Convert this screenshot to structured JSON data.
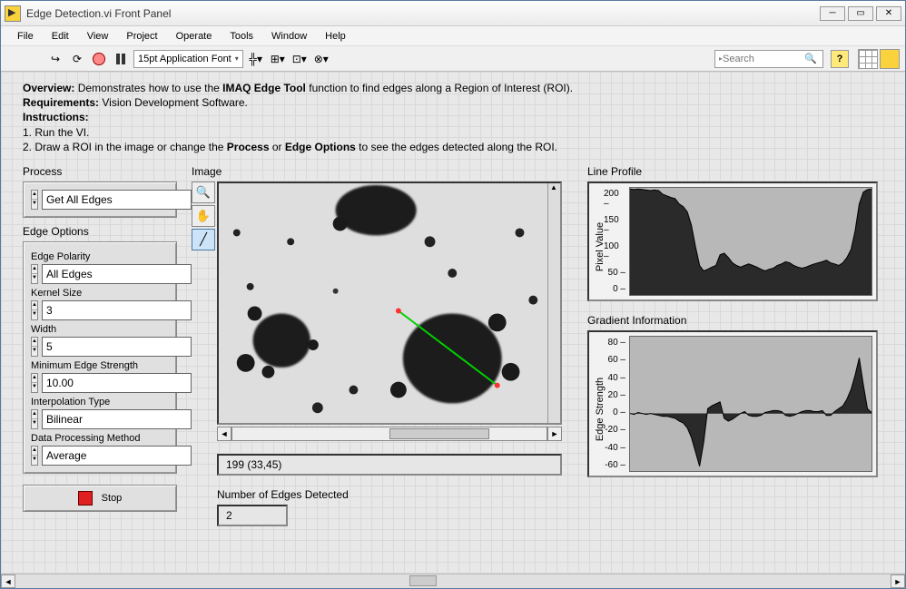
{
  "window": {
    "title": "Edge Detection.vi Front Panel"
  },
  "menu": [
    "File",
    "Edit",
    "View",
    "Project",
    "Operate",
    "Tools",
    "Window",
    "Help"
  ],
  "toolbar": {
    "font": "15pt Application Font",
    "search_placeholder": "Search"
  },
  "overview": {
    "l1a": "Overview:",
    "l1b": " Demonstrates how to use the ",
    "l1c": "IMAQ Edge Tool",
    "l1d": " function to find edges along a Region of Interest (ROI).",
    "l2a": "Requirements:",
    "l2b": " Vision Development Software.",
    "l3": "Instructions:",
    "l4": "1. Run the VI.",
    "l5a": "2. Draw a ROI in the image or change the ",
    "l5b": "Process",
    "l5c": " or ",
    "l5d": "Edge Options",
    "l5e": " to see the edges detected along the ROI."
  },
  "labels": {
    "process": "Process",
    "edge_options": "Edge Options",
    "edge_polarity": "Edge Polarity",
    "kernel_size": "Kernel Size",
    "width": "Width",
    "min_edge": "Minimum Edge Strength",
    "interp": "Interpolation Type",
    "dpm": "Data Processing Method",
    "stop": "Stop",
    "image": "Image",
    "ned": "Number of Edges Detected",
    "line_profile": "Line Profile",
    "gradient": "Gradient Information",
    "pixel_value": "Pixel Value",
    "edge_strength": "Edge Strength"
  },
  "controls": {
    "process": "Get All Edges",
    "edge_polarity": "All Edges",
    "kernel_size": "3",
    "width": "5",
    "min_edge": "10.00",
    "interp": "Bilinear",
    "dpm": "Average"
  },
  "status": "199    (33,45)",
  "ned": "2",
  "chart_data": [
    {
      "type": "line",
      "title": "Line Profile",
      "ylabel": "Pixel Value",
      "ylim": [
        0,
        200
      ],
      "yticks": [
        0,
        50,
        100,
        150,
        200
      ],
      "values": [
        198,
        197,
        198,
        197,
        196,
        195,
        196,
        195,
        188,
        185,
        182,
        180,
        170,
        165,
        155,
        130,
        90,
        55,
        45,
        48,
        52,
        55,
        75,
        78,
        70,
        60,
        55,
        52,
        55,
        58,
        55,
        52,
        48,
        45,
        48,
        50,
        55,
        58,
        62,
        60,
        55,
        52,
        50,
        52,
        55,
        58,
        60,
        62,
        65,
        60,
        58,
        55,
        60,
        70,
        85,
        120,
        170,
        192,
        197,
        198
      ]
    },
    {
      "type": "line",
      "title": "Gradient Information",
      "ylabel": "Edge Strength",
      "ylim": [
        -60,
        80
      ],
      "yticks": [
        -60,
        -40,
        -20,
        0,
        20,
        40,
        60,
        80
      ],
      "values": [
        0,
        -1,
        1,
        0,
        -1,
        0,
        -1,
        -2,
        -3,
        -3,
        -4,
        -5,
        -8,
        -10,
        -15,
        -25,
        -40,
        -55,
        -30,
        5,
        8,
        10,
        12,
        -5,
        -8,
        -6,
        -3,
        0,
        2,
        -2,
        -3,
        -3,
        -2,
        1,
        2,
        3,
        3,
        2,
        -2,
        -3,
        -2,
        0,
        2,
        3,
        3,
        2,
        2,
        3,
        -2,
        -2,
        2,
        5,
        8,
        15,
        25,
        40,
        58,
        30,
        5,
        1
      ]
    }
  ]
}
